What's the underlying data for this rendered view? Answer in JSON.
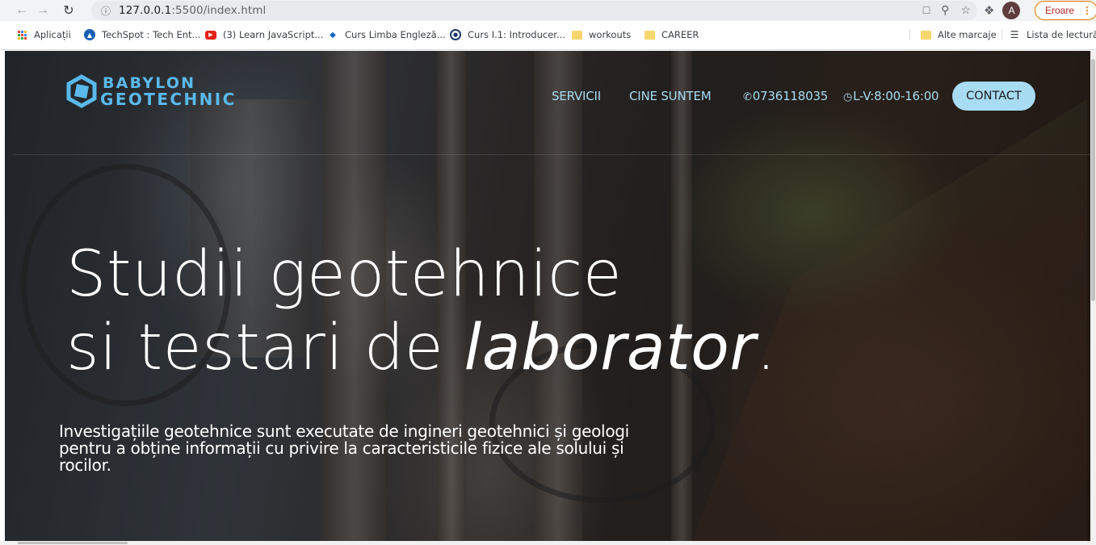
{
  "browser": {
    "url_host": "127.0.0.1",
    "url_path": ":5500/index.html",
    "profile_initial": "A",
    "error_label": "Eroare"
  },
  "bookmarks": [
    {
      "label": "Aplicații",
      "icon": "apps-grid-icon"
    },
    {
      "label": "TechSpot : Tech Ent...",
      "icon": "techspot-icon"
    },
    {
      "label": "(3) Learn JavaScript...",
      "icon": "youtube-icon"
    },
    {
      "label": "Curs Limba Engleză...",
      "icon": "course-icon"
    },
    {
      "label": "Curs I.1: Introducer...",
      "icon": "globe-icon"
    },
    {
      "label": "workouts",
      "icon": "folder-icon"
    },
    {
      "label": "CAREER",
      "icon": "folder-icon"
    }
  ],
  "bookmarks_right": {
    "other": "Alte marcaje",
    "reading_list": "Lista de lectură"
  },
  "site": {
    "logo_line1": "BABYLON",
    "logo_line2": "GEOTECHNIC",
    "nav": {
      "services": "SERVICII",
      "about": "CINE SUNTEM",
      "phone": "0736118035",
      "hours": "L-V:8:00-16:00",
      "contact": "CONTACT"
    },
    "hero": {
      "title_line1": "Studii geotehnice",
      "title_line2_prefix": "si testari de ",
      "title_line2_em": "laborator",
      "title_line2_suffix": ".",
      "subtitle": "Investigațiile geotehnice sunt executate de ingineri geotehnici și geologi pentru a obține informații cu privire la caracteristicile fizice ale solului și rocilor."
    }
  },
  "colors": {
    "accent": "#a8dcf3",
    "logo": "#5ab9ea"
  }
}
